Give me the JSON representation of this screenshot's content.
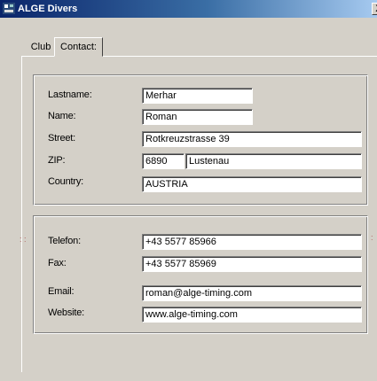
{
  "window": {
    "title": "ALGE Divers",
    "close_label": "X"
  },
  "tabs": [
    {
      "label": "Club"
    },
    {
      "label": "Contact:"
    }
  ],
  "contact": {
    "lastname": {
      "label": "Lastname:",
      "value": "Merhar"
    },
    "name": {
      "label": "Name:",
      "value": "Roman"
    },
    "street": {
      "label": "Street:",
      "value": "Rotkreuzstrasse 39"
    },
    "zip": {
      "label": "ZIP:",
      "zip_value": "6890",
      "city_value": "Lustenau"
    },
    "country": {
      "label": "Country:",
      "value": "AUSTRIA"
    },
    "telefon": {
      "label": "Telefon:",
      "value": "+43 5577 85966"
    },
    "fax": {
      "label": "Fax:",
      "value": "+43 5577 85969"
    },
    "email": {
      "label": "Email:",
      "value": "roman@alge-timing.com"
    },
    "website": {
      "label": "Website:",
      "value": "www.alge-timing.com"
    }
  }
}
